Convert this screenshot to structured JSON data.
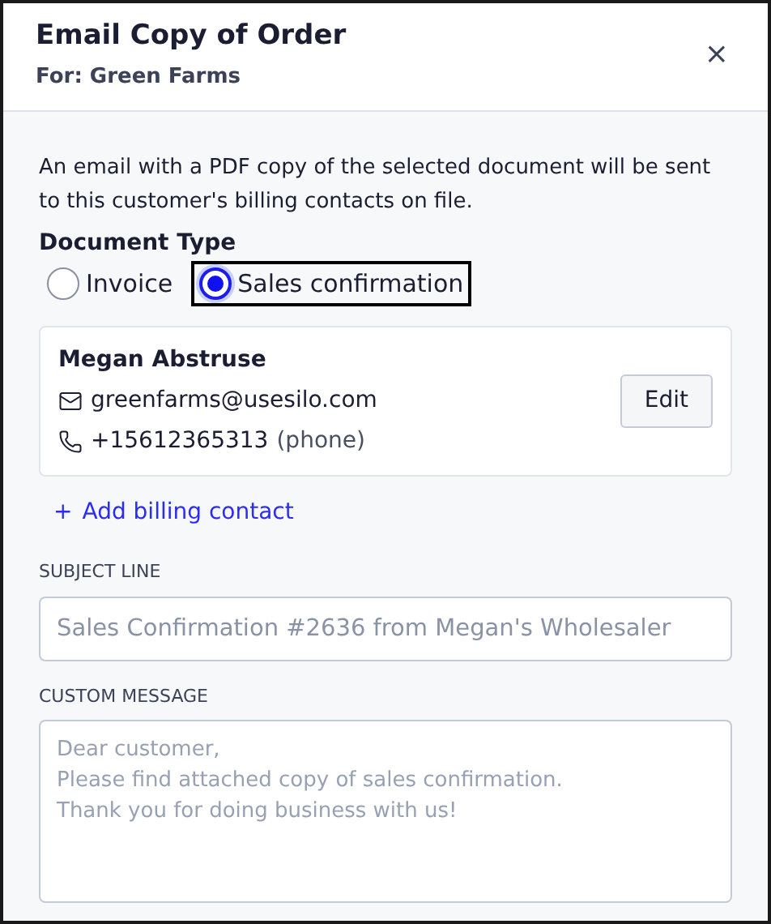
{
  "dialog": {
    "title": "Email Copy of Order",
    "subtitle": "For: Green Farms",
    "close": "×"
  },
  "description": "An email with a PDF copy of the selected document will be sent to this customer's billing contacts on file.",
  "document_type": {
    "label": "Document Type",
    "options": [
      {
        "label": "Invoice",
        "selected": false
      },
      {
        "label": "Sales confirmation",
        "selected": true
      }
    ]
  },
  "contact": {
    "name": "Megan Abstruse",
    "email": "greenfarms@usesilo.com",
    "phone": "+15612365313",
    "phone_note": "(phone)",
    "edit": "Edit"
  },
  "add_contact": {
    "icon": "+",
    "label": "Add billing contact"
  },
  "subject": {
    "label": "SUBJECT LINE",
    "placeholder": "Sales Confirmation #2636 from Megan's Wholesaler"
  },
  "message": {
    "label": "CUSTOM MESSAGE",
    "placeholder": "Dear customer,\nPlease find attached copy of sales confirmation.\nThank you for doing business with us!"
  }
}
